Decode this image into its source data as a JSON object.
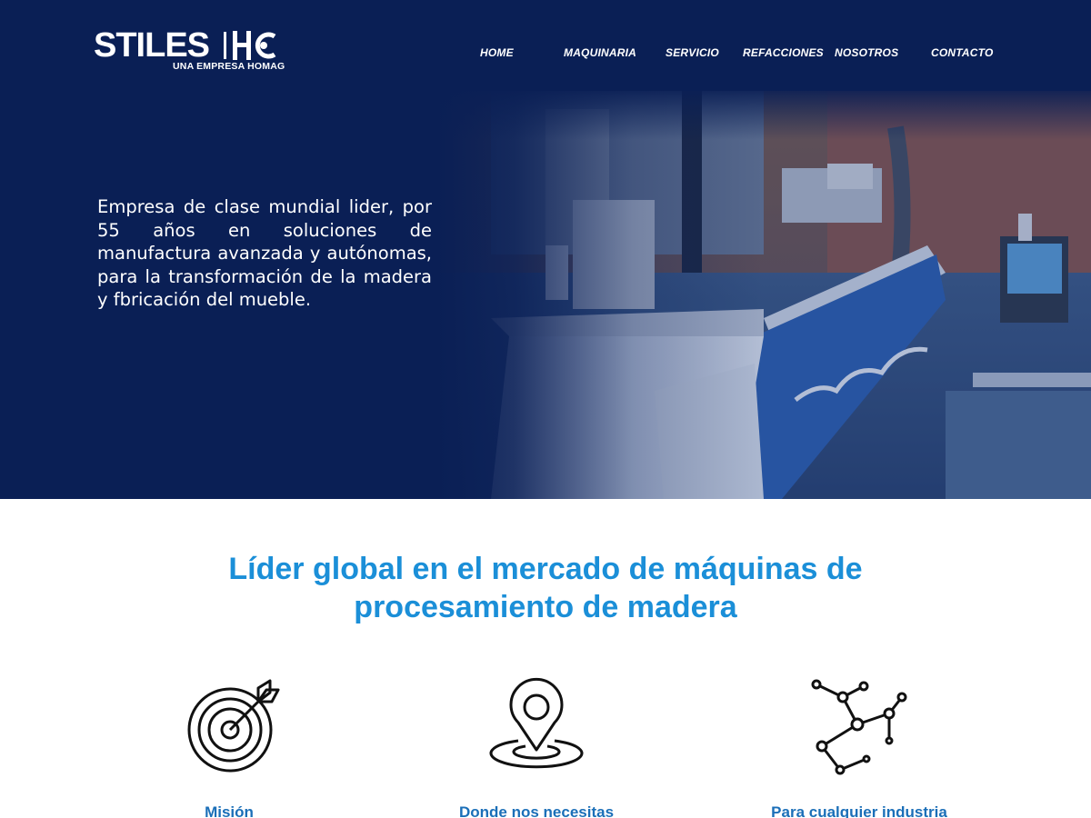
{
  "brand": {
    "name": "STILES",
    "mark": "HC",
    "tagline": "UNA EMPRESA HOMAG"
  },
  "nav": {
    "items": [
      {
        "label": "HOME"
      },
      {
        "label": "MAQUINARIA"
      },
      {
        "label": "SERVICIO"
      },
      {
        "label": "REFACCIONES"
      },
      {
        "label": "NOSOTROS"
      },
      {
        "label": "CONTACTO"
      }
    ]
  },
  "hero": {
    "text": "Empresa de clase mundial lider, por 55 años en soluciones de manufactura avanzada y autónomas, para la transformación de la madera y fbricación del mueble.",
    "image_icon": "factory-machine-photo"
  },
  "section": {
    "headline_line1": "Líder global en el mercado de máquinas de",
    "headline_line2": "procesamiento de madera"
  },
  "features": [
    {
      "title": "Misión",
      "icon": "target-arrow-icon"
    },
    {
      "title": "Donde nos necesitas",
      "icon": "location-pin-icon"
    },
    {
      "title": "Para cualquier industria",
      "icon": "network-nodes-icon"
    }
  ],
  "colors": {
    "hero_bg": "#0a1f55",
    "accent": "#1b8fd8",
    "feature_title": "#1b6fb8",
    "nav_text": "#ffffff"
  }
}
